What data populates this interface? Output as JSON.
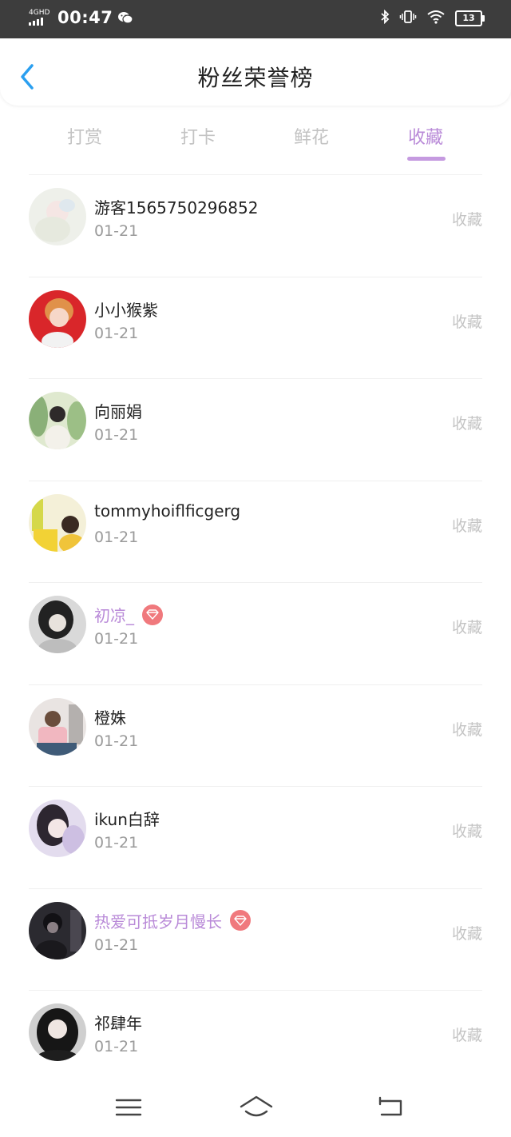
{
  "status_bar": {
    "network": "4GHD",
    "time": "00:47",
    "battery": "13"
  },
  "header": {
    "title": "粉丝荣誉榜"
  },
  "tabs": [
    {
      "label": "打赏",
      "active": false
    },
    {
      "label": "打卡",
      "active": false
    },
    {
      "label": "鲜花",
      "active": false
    },
    {
      "label": "收藏",
      "active": true
    }
  ],
  "fans": [
    {
      "name": "游客1565750296852",
      "date": "01-21",
      "action": "收藏",
      "vip": false
    },
    {
      "name": "小小猴紫",
      "date": "01-21",
      "action": "收藏",
      "vip": false
    },
    {
      "name": "向丽娟",
      "date": "01-21",
      "action": "收藏",
      "vip": false
    },
    {
      "name": "tommyhoiflficgerg",
      "date": "01-21",
      "action": "收藏",
      "vip": false
    },
    {
      "name": "初凉_",
      "date": "01-21",
      "action": "收藏",
      "vip": true
    },
    {
      "name": "橙姝",
      "date": "01-21",
      "action": "收藏",
      "vip": false
    },
    {
      "name": "ikun白辞",
      "date": "01-21",
      "action": "收藏",
      "vip": false
    },
    {
      "name": "热爱可抵岁月慢长",
      "date": "01-21",
      "action": "收藏",
      "vip": true
    },
    {
      "name": "祁肆年",
      "date": "01-21",
      "action": "收藏",
      "vip": false
    }
  ],
  "nav": {
    "icons": [
      "menu-icon",
      "home-icon",
      "back-icon"
    ]
  },
  "colors": {
    "accent": "#b98ad8",
    "back_arrow": "#2a9ff0",
    "vip_badge": "#f0797d",
    "status_bar": "#3d3d3d"
  }
}
